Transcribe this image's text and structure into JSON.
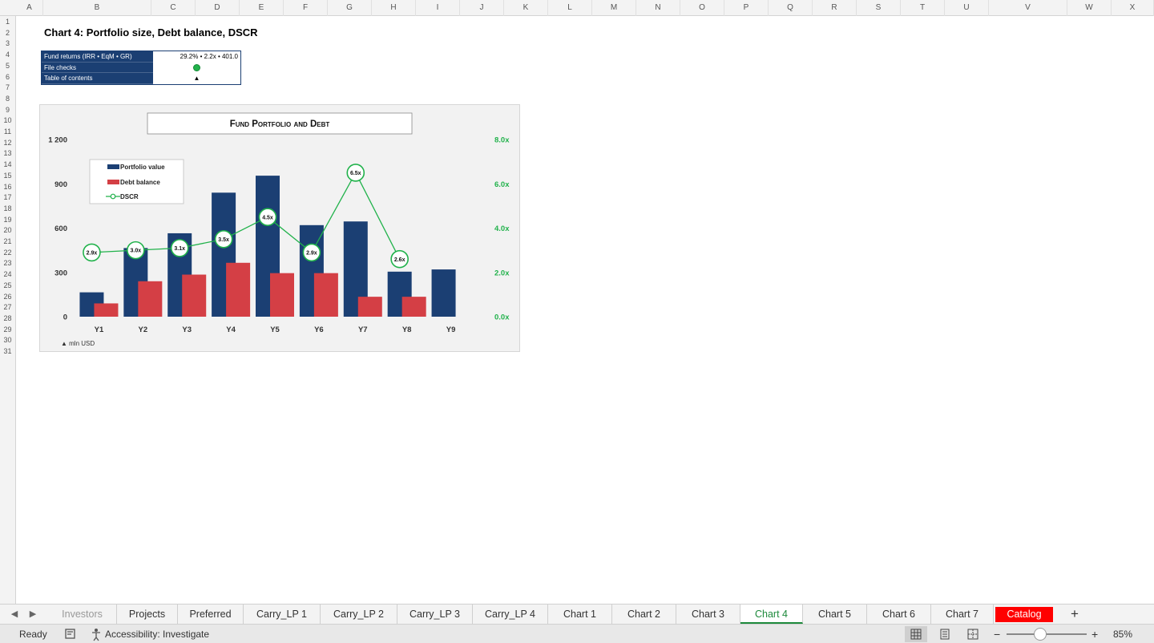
{
  "columns": [
    {
      "letter": "A"
    },
    {
      "letter": "B"
    },
    {
      "letter": "C"
    },
    {
      "letter": "D"
    },
    {
      "letter": "E"
    },
    {
      "letter": "F"
    },
    {
      "letter": "G"
    },
    {
      "letter": "H"
    },
    {
      "letter": "I"
    },
    {
      "letter": "J"
    },
    {
      "letter": "K"
    },
    {
      "letter": "L"
    },
    {
      "letter": "M"
    },
    {
      "letter": "N"
    },
    {
      "letter": "O"
    },
    {
      "letter": "P"
    },
    {
      "letter": "Q"
    },
    {
      "letter": "R"
    },
    {
      "letter": "S"
    },
    {
      "letter": "T"
    },
    {
      "letter": "U"
    },
    {
      "letter": "V"
    },
    {
      "letter": "W"
    },
    {
      "letter": "X"
    }
  ],
  "rows": [
    "1",
    "2",
    "3",
    "4",
    "5",
    "6",
    "7",
    "8",
    "9",
    "10",
    "11",
    "12",
    "13",
    "14",
    "15",
    "16",
    "17",
    "18",
    "19",
    "20",
    "21",
    "22",
    "23",
    "24",
    "25",
    "26",
    "27",
    "28",
    "29",
    "30",
    "31"
  ],
  "sheet": {
    "title": "Chart 4: Portfolio size, Debt balance, DSCR",
    "info": {
      "fund_returns_label": "Fund returns (IRR • EqM • GR)",
      "fund_returns_value": "29.2% • 2.2x • 401.0",
      "file_checks_label": "File checks",
      "file_checks_status": "ok",
      "toc_label": "Table of contents",
      "toc_arrow": "▲"
    }
  },
  "chart_data": {
    "type": "bar",
    "title": "Fund Portfolio and Debt",
    "categories": [
      "Y1",
      "Y2",
      "Y3",
      "Y4",
      "Y5",
      "Y6",
      "Y7",
      "Y8",
      "Y9"
    ],
    "series": [
      {
        "name": "Portfolio value",
        "kind": "bar",
        "axis": "left",
        "color": "#1b3f73",
        "values": [
          165,
          465,
          565,
          840,
          955,
          620,
          645,
          305,
          320
        ]
      },
      {
        "name": "Debt balance",
        "kind": "bar",
        "axis": "left",
        "color": "#d43f45",
        "values": [
          90,
          240,
          285,
          365,
          295,
          295,
          135,
          135,
          null
        ]
      },
      {
        "name": "DSCR",
        "kind": "line",
        "axis": "right",
        "color": "#21b24b",
        "values": [
          2.9,
          3.0,
          3.1,
          3.5,
          4.5,
          2.9,
          6.5,
          2.6,
          null
        ],
        "labels": [
          "2.9x",
          "3.0x",
          "3.1x",
          "3.5x",
          "4.5x",
          "2.9x",
          "6.5x",
          "2.6x",
          ""
        ]
      }
    ],
    "ylim_left": [
      0,
      1200
    ],
    "yticks_left": [
      0,
      300,
      600,
      900,
      1200
    ],
    "ytick_labels_left": [
      "0",
      "300",
      "600",
      "900",
      "1 200"
    ],
    "ylim_right": [
      0,
      8
    ],
    "yticks_right": [
      0,
      2,
      4,
      6,
      8
    ],
    "ytick_labels_right": [
      "0.0x",
      "2.0x",
      "4.0x",
      "6.0x",
      "8.0x"
    ],
    "right_axis_color": "#21b24b",
    "legend_position": "top-left",
    "grid": false,
    "note": "▲ mln USD"
  },
  "tabs": [
    {
      "label": "Investors",
      "state": "dim"
    },
    {
      "label": "Projects",
      "state": ""
    },
    {
      "label": "Preferred",
      "state": ""
    },
    {
      "label": "Carry_LP 1",
      "state": ""
    },
    {
      "label": "Carry_LP 2",
      "state": ""
    },
    {
      "label": "Carry_LP 3",
      "state": ""
    },
    {
      "label": "Carry_LP 4",
      "state": ""
    },
    {
      "label": "Chart 1",
      "state": ""
    },
    {
      "label": "Chart 2",
      "state": ""
    },
    {
      "label": "Chart 3",
      "state": ""
    },
    {
      "label": "Chart 4",
      "state": "active"
    },
    {
      "label": "Chart 5",
      "state": ""
    },
    {
      "label": "Chart 6",
      "state": ""
    },
    {
      "label": "Chart 7",
      "state": ""
    },
    {
      "label": "Catalog",
      "state": "catalog"
    }
  ],
  "tab_add": "+",
  "status": {
    "ready": "Ready",
    "accessibility": "Accessibility: Investigate",
    "zoom_minus": "−",
    "zoom_plus": "+",
    "zoom_level": "85%",
    "zoom_fraction": 0.42
  }
}
